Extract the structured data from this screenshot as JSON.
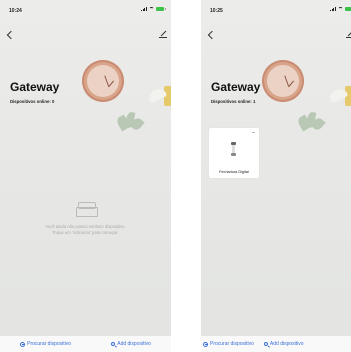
{
  "screens": [
    {
      "status_time": "10:24",
      "title": "Gateway",
      "devices_online": "Dispositivos online: 0",
      "empty_line1": "Você ainda não possui nenhum dispositivo.",
      "empty_line2": "Toque em 'Adicionar' para começar.",
      "bottom": {
        "scan_label": "Procurar dispositivo",
        "add_label": "Add dispositivo"
      }
    },
    {
      "status_time": "10:25",
      "title": "Gateway",
      "devices_online": "Dispositivos online: 1",
      "device": {
        "name": "Fechadura Digital",
        "more": "..."
      },
      "bottom": {
        "scan_label": "Procurar dispositivo",
        "add_label": "Add dispositivo"
      }
    }
  ],
  "colors": {
    "accent": "#3a6fd8",
    "battery": "#3cc24a",
    "clock": "#d8a48a"
  },
  "icons": [
    "back-icon",
    "edit-icon",
    "plus-icon",
    "search-icon",
    "lock-icon",
    "more-icon"
  ]
}
